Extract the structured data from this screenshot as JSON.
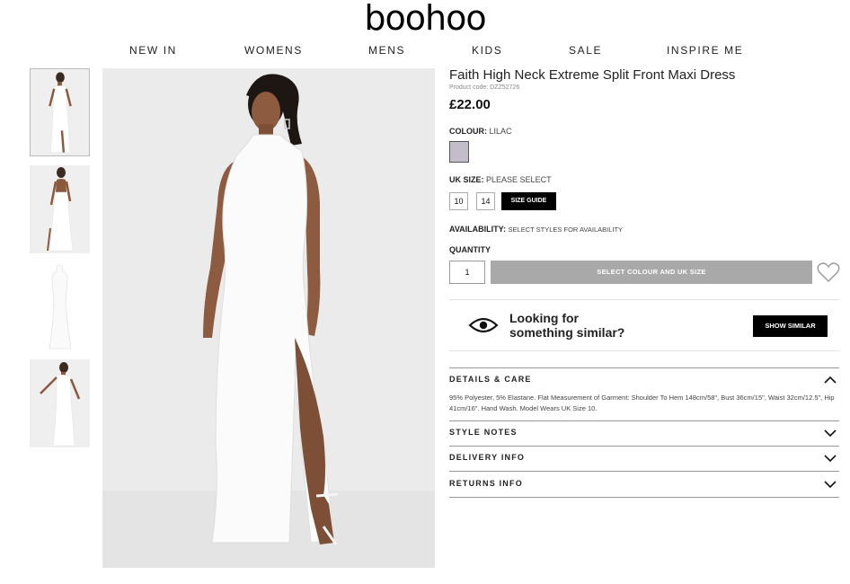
{
  "brand": {
    "logo_text": "boohoo"
  },
  "nav": [
    "NEW IN",
    "WOMENS",
    "MENS",
    "KIDS",
    "SALE",
    "INSPIRE ME"
  ],
  "product": {
    "title": "Faith High Neck Extreme Split Front Maxi Dress",
    "code": "Product code: DZZ52726",
    "price": "£22.00"
  },
  "colour": {
    "label": "COLOUR:",
    "value": "LILAC",
    "swatch_color": "#c3bdc9"
  },
  "size": {
    "label": "UK SIZE:",
    "value": "PLEASE SELECT",
    "options": [
      "10",
      "14"
    ],
    "guide_label": "SIZE GUIDE"
  },
  "availability": {
    "label": "AVAILABILITY:",
    "value": "SELECT STYLES FOR AVAILABILITY"
  },
  "quantity": {
    "label": "QUANTITY",
    "value": "1"
  },
  "add_button": "SELECT COLOUR AND UK SIZE",
  "similar": {
    "line1": "Looking for",
    "line2": "something similar?",
    "button": "SHOW SIMILAR"
  },
  "details": {
    "title": "DETAILS & CARE",
    "body": "95% Polyester, 5% Elastane. Flat Measurement of Garment: Shoulder To Hem 148cm/58\", Bust 36cm/15\", Waist 32cm/12.5\", Hip 41cm/16\". Hand Wash. Model Wears UK Size 10."
  },
  "accordions": [
    "STYLE NOTES",
    "DELIVERY INFO",
    "RETURNS INFO"
  ],
  "icons": {
    "wishlist": "heart-icon",
    "similar": "eye-icon",
    "expand": "chevron-down-icon",
    "collapse": "chevron-up-icon"
  },
  "colors": {
    "button_disabled": "#a9a9a9",
    "primary_button": "#000000"
  }
}
